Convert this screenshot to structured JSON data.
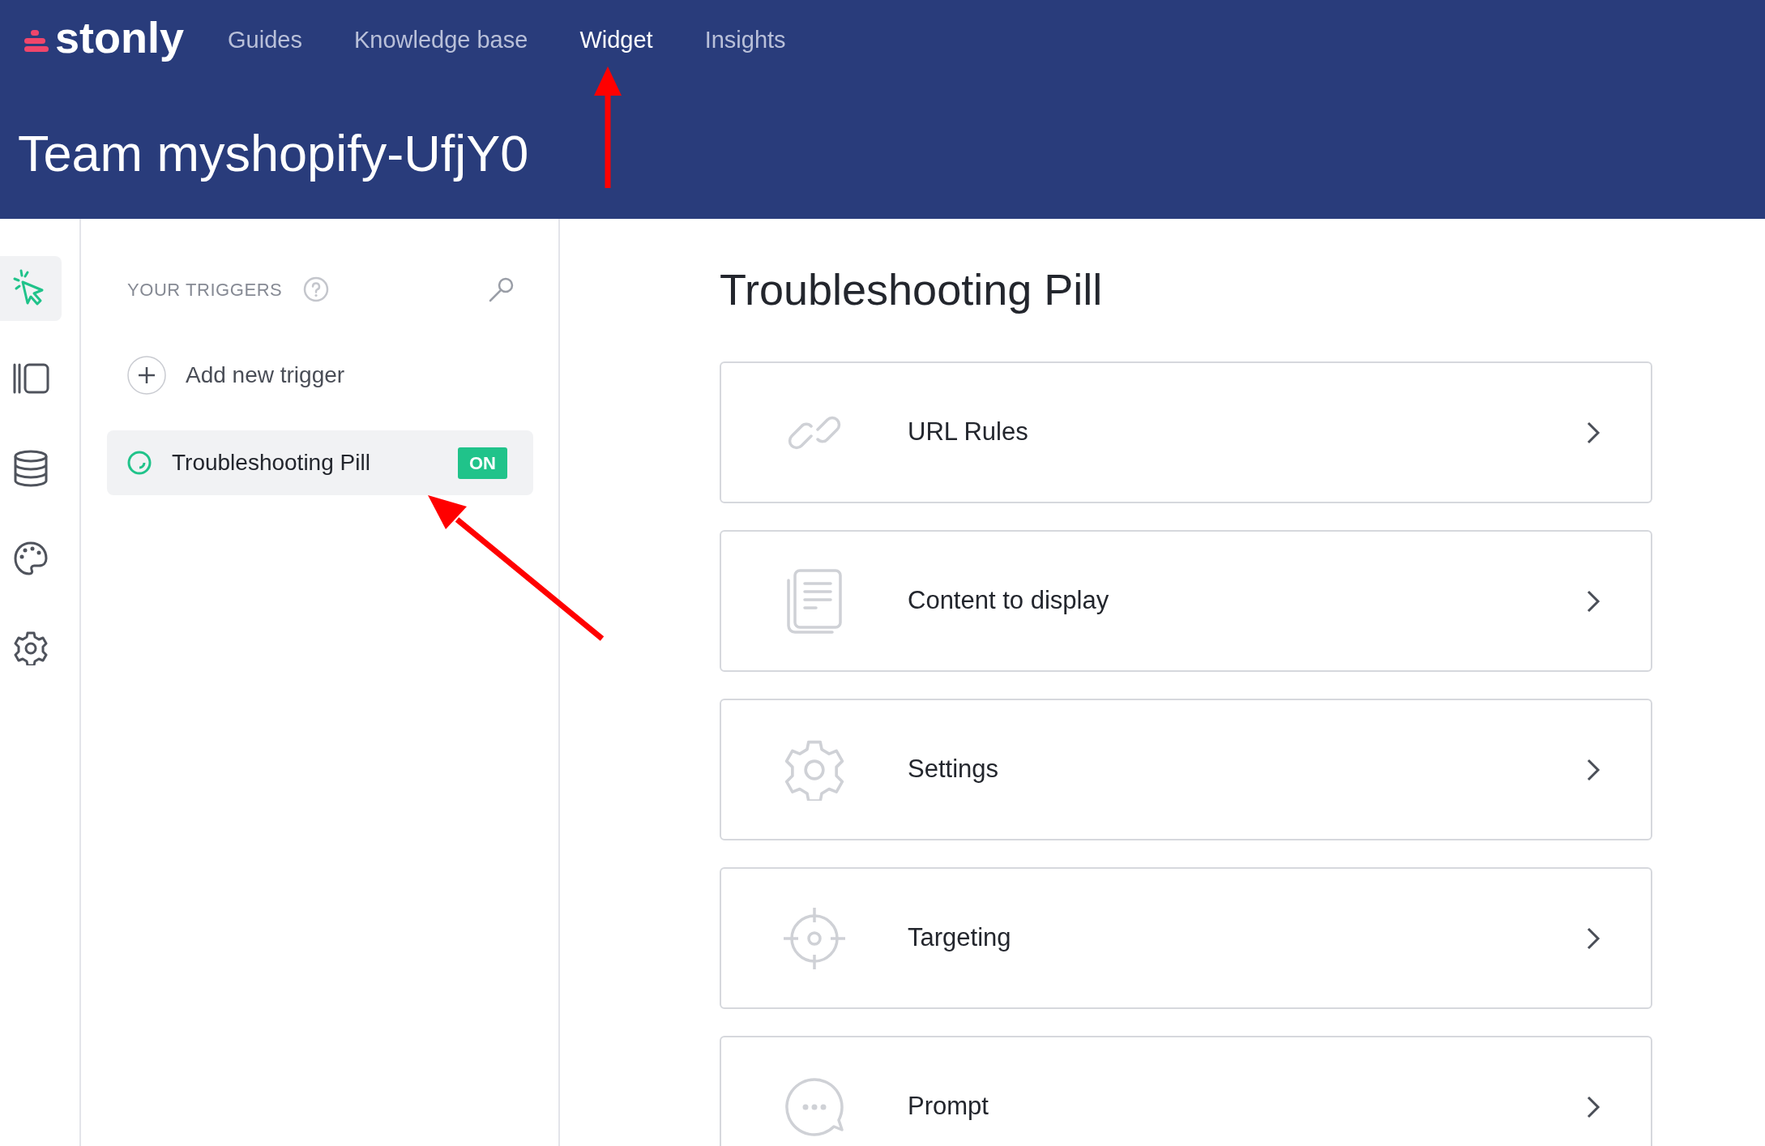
{
  "header": {
    "logo": "stonly",
    "nav": [
      {
        "label": "Guides",
        "selected": false
      },
      {
        "label": "Knowledge base",
        "selected": false
      },
      {
        "label": "Widget",
        "selected": true
      },
      {
        "label": "Insights",
        "selected": false
      }
    ],
    "team_title": "Team myshopify-UfjY0"
  },
  "rail": [
    {
      "kind": "cursor",
      "selected": true
    },
    {
      "kind": "panels",
      "selected": false
    },
    {
      "kind": "database",
      "selected": false
    },
    {
      "kind": "palette",
      "selected": false
    },
    {
      "kind": "gear",
      "selected": false
    }
  ],
  "triggers_panel": {
    "heading": "YOUR TRIGGERS",
    "add_label": "Add new trigger",
    "items": [
      {
        "name": "Troubleshooting Pill",
        "status": "ON",
        "on": true,
        "selected": true
      }
    ]
  },
  "main": {
    "title": "Troubleshooting Pill",
    "cards": [
      {
        "kind": "link",
        "label": "URL Rules"
      },
      {
        "kind": "document",
        "label": "Content to display"
      },
      {
        "kind": "gear",
        "label": "Settings"
      },
      {
        "kind": "target",
        "label": "Targeting"
      },
      {
        "kind": "chat",
        "label": "Prompt"
      }
    ]
  }
}
